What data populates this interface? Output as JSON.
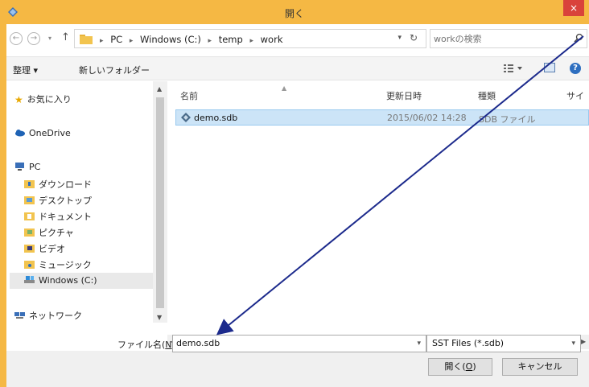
{
  "window": {
    "title": "開く",
    "close_glyph": "×"
  },
  "nav": {
    "back_glyph": "←",
    "forward_glyph": "→",
    "recent_glyph": "▾",
    "up_glyph": "↑",
    "breadcrumbs": [
      "PC",
      "Windows (C:)",
      "temp",
      "work"
    ],
    "crumb_sep": "▸",
    "refresh_glyph": "↻",
    "search_placeholder": "workの検索"
  },
  "toolbar": {
    "organize_label": "整理 ▾",
    "new_folder_label": "新しいフォルダー"
  },
  "sidebar": {
    "favorites": "お気に入り",
    "onedrive": "OneDrive",
    "pc": "PC",
    "downloads": "ダウンロード",
    "desktop": "デスクトップ",
    "documents": "ドキュメント",
    "pictures": "ピクチャ",
    "videos": "ビデオ",
    "music": "ミュージック",
    "windows_c": "Windows (C:)",
    "network": "ネットワーク"
  },
  "filelist": {
    "columns": {
      "name": "名前",
      "modified": "更新日時",
      "type": "種類",
      "size": "サイ"
    },
    "rows": [
      {
        "name": "demo.sdb",
        "modified": "2015/06/02 14:28",
        "type": "SDB ファイル"
      }
    ]
  },
  "bottom": {
    "filename_label_pre": "ファイル名(",
    "filename_label_key": "N",
    "filename_label_post": "):",
    "filename_value": "demo.sdb",
    "filetype_value": "SST Files (*.sdb)",
    "open_pre": "開く(",
    "open_key": "O",
    "open_post": ")",
    "cancel_label": "キャンセル"
  },
  "colors": {
    "titlebar": "#f5b844",
    "selection": "#cce4f7",
    "arrow": "#1c2a8c",
    "close": "#d9423b"
  }
}
